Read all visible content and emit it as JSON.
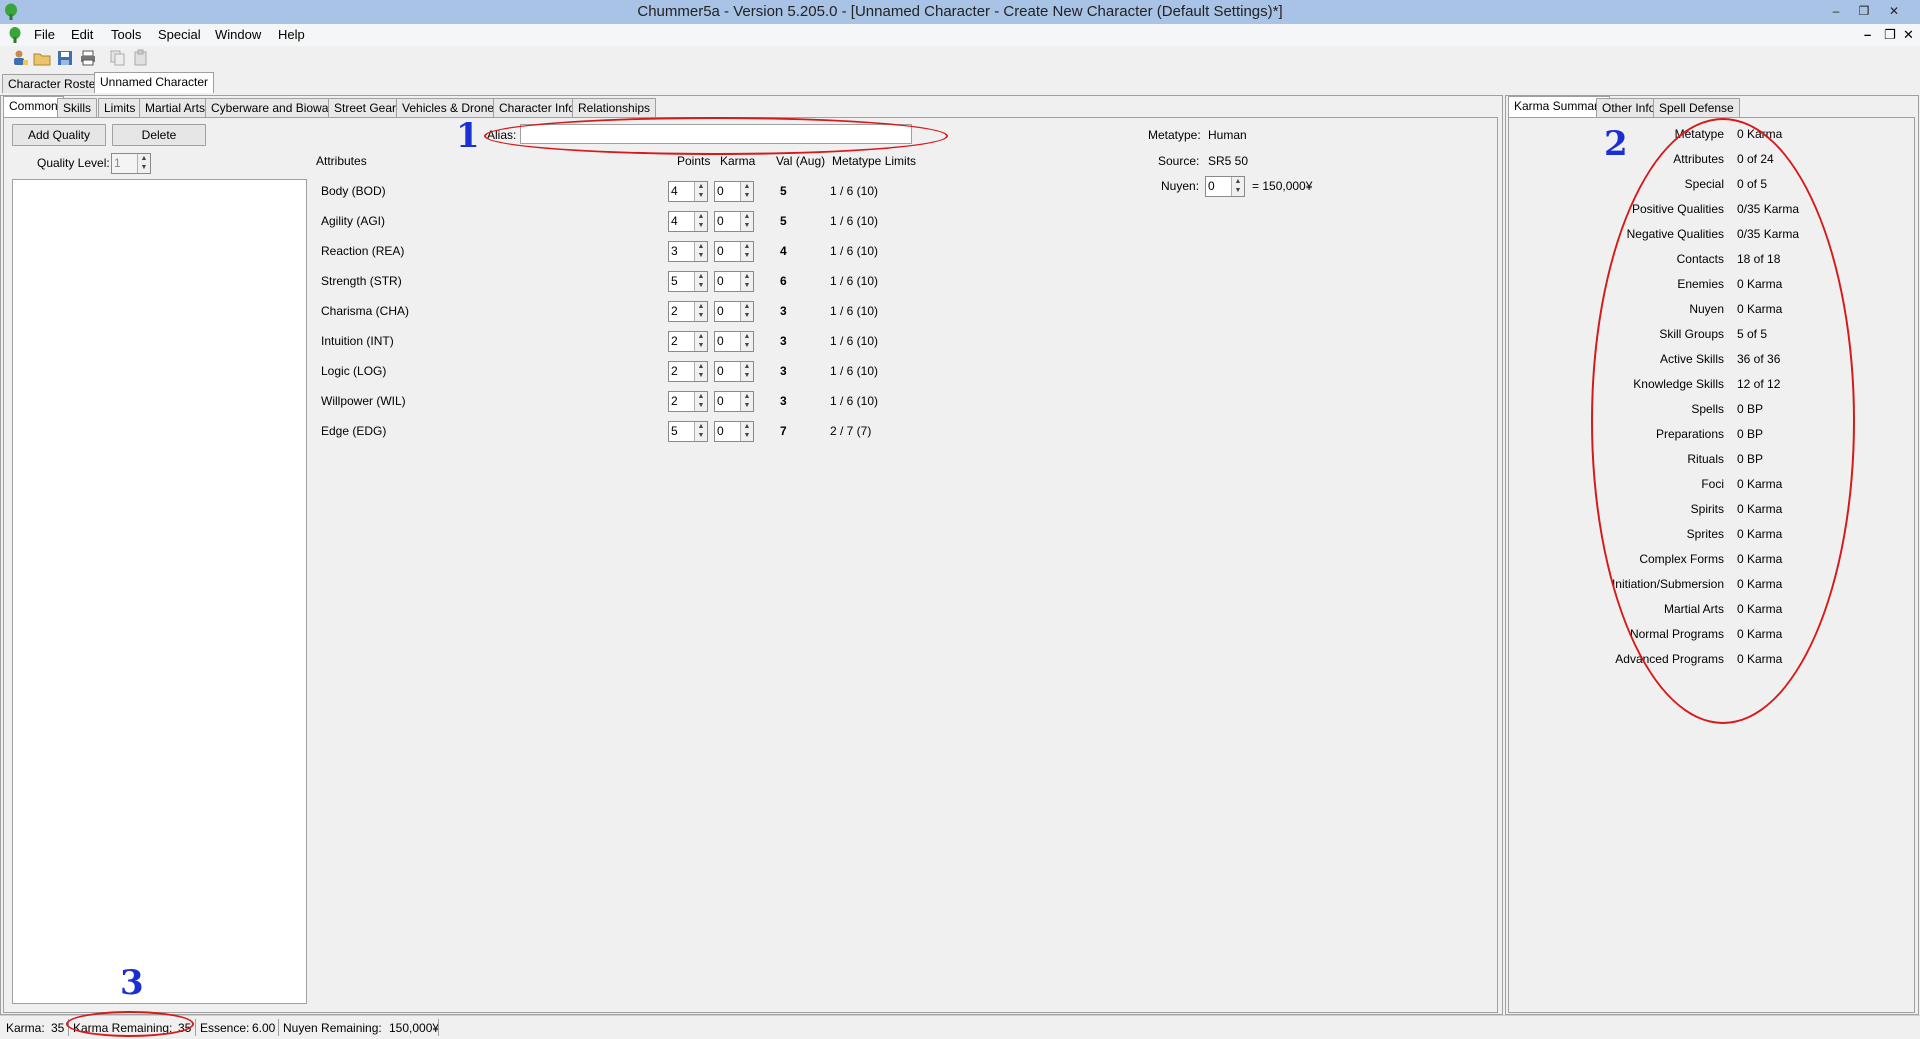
{
  "window": {
    "title": "Chummer5a - Version 5.205.0 - [Unnamed Character - Create New Character (Default Settings)*]"
  },
  "menu": [
    "File",
    "Edit",
    "Tools",
    "Special",
    "Window",
    "Help"
  ],
  "document_tabs": [
    "Character Roster",
    "Unnamed Character"
  ],
  "main_tabs": [
    "Common",
    "Skills",
    "Limits",
    "Martial Arts",
    "Cyberware and Bioware",
    "Street Gear",
    "Vehicles & Drones",
    "Character Info",
    "Relationships"
  ],
  "common": {
    "add_quality": "Add Quality",
    "delete": "Delete",
    "quality_level_label": "Quality Level:",
    "quality_level_value": "1",
    "alias_label": "Alias:",
    "alias_value": "",
    "metatype_label": "Metatype:",
    "metatype_value": "Human",
    "source_label": "Source:",
    "source_value": "SR5 50",
    "nuyen_label": "Nuyen:",
    "nuyen_value": "0",
    "nuyen_total": "= 150,000¥"
  },
  "attributes": {
    "headers": {
      "attributes": "Attributes",
      "points": "Points",
      "karma": "Karma",
      "val": "Val (Aug)",
      "limits": "Metatype Limits"
    },
    "rows": [
      {
        "name": "Body (BOD)",
        "points": "4",
        "karma": "0",
        "val": "5",
        "limits": "1 / 6 (10)"
      },
      {
        "name": "Agility (AGI)",
        "points": "4",
        "karma": "0",
        "val": "5",
        "limits": "1 / 6 (10)"
      },
      {
        "name": "Reaction (REA)",
        "points": "3",
        "karma": "0",
        "val": "4",
        "limits": "1 / 6 (10)"
      },
      {
        "name": "Strength (STR)",
        "points": "5",
        "karma": "0",
        "val": "6",
        "limits": "1 / 6 (10)"
      },
      {
        "name": "Charisma (CHA)",
        "points": "2",
        "karma": "0",
        "val": "3",
        "limits": "1 / 6 (10)"
      },
      {
        "name": "Intuition (INT)",
        "points": "2",
        "karma": "0",
        "val": "3",
        "limits": "1 / 6 (10)"
      },
      {
        "name": "Logic (LOG)",
        "points": "2",
        "karma": "0",
        "val": "3",
        "limits": "1 / 6 (10)"
      },
      {
        "name": "Willpower (WIL)",
        "points": "2",
        "karma": "0",
        "val": "3",
        "limits": "1 / 6 (10)"
      },
      {
        "name": "Edge (EDG)",
        "points": "5",
        "karma": "0",
        "val": "7",
        "limits": "2 / 7 (7)"
      }
    ]
  },
  "right_tabs": [
    "Karma Summary",
    "Other Info",
    "Spell Defense"
  ],
  "karma_summary": [
    {
      "label": "Metatype",
      "value": "0 Karma"
    },
    {
      "label": "Attributes",
      "value": "0 of 24"
    },
    {
      "label": "Special",
      "value": "0 of 5"
    },
    {
      "label": "Positive Qualities",
      "value": "0/35 Karma"
    },
    {
      "label": "Negative Qualities",
      "value": "0/35 Karma"
    },
    {
      "label": "Contacts",
      "value": "18 of 18"
    },
    {
      "label": "Enemies",
      "value": "0 Karma"
    },
    {
      "label": "Nuyen",
      "value": "0 Karma"
    },
    {
      "label": "Skill Groups",
      "value": "5 of 5"
    },
    {
      "label": "Active Skills",
      "value": "36 of 36"
    },
    {
      "label": "Knowledge Skills",
      "value": "12 of 12"
    },
    {
      "label": "Spells",
      "value": "0 BP"
    },
    {
      "label": "Preparations",
      "value": "0 BP"
    },
    {
      "label": "Rituals",
      "value": "0 BP"
    },
    {
      "label": "Foci",
      "value": "0 Karma"
    },
    {
      "label": "Spirits",
      "value": "0 Karma"
    },
    {
      "label": "Sprites",
      "value": "0 Karma"
    },
    {
      "label": "Complex Forms",
      "value": "0 Karma"
    },
    {
      "label": "Initiation/Submersion",
      "value": "0 Karma"
    },
    {
      "label": "Martial Arts",
      "value": "0 Karma"
    },
    {
      "label": "Normal Programs",
      "value": "0 Karma"
    },
    {
      "label": "Advanced Programs",
      "value": "0 Karma"
    }
  ],
  "status": {
    "karma_label": "Karma:",
    "karma_value": "35",
    "karma_remaining_label": "Karma Remaining:",
    "karma_remaining_value": "35",
    "essence_label": "Essence:",
    "essence_value": "6.00",
    "nuyen_remaining_label": "Nuyen Remaining:",
    "nuyen_remaining_value": "150,000¥"
  },
  "annotations": [
    "1",
    "2",
    "3"
  ],
  "colors": {
    "titlebar": "#a9c3e6",
    "annotation_number": "#1c2fd0",
    "annotation_ellipse": "#d61a1a"
  }
}
